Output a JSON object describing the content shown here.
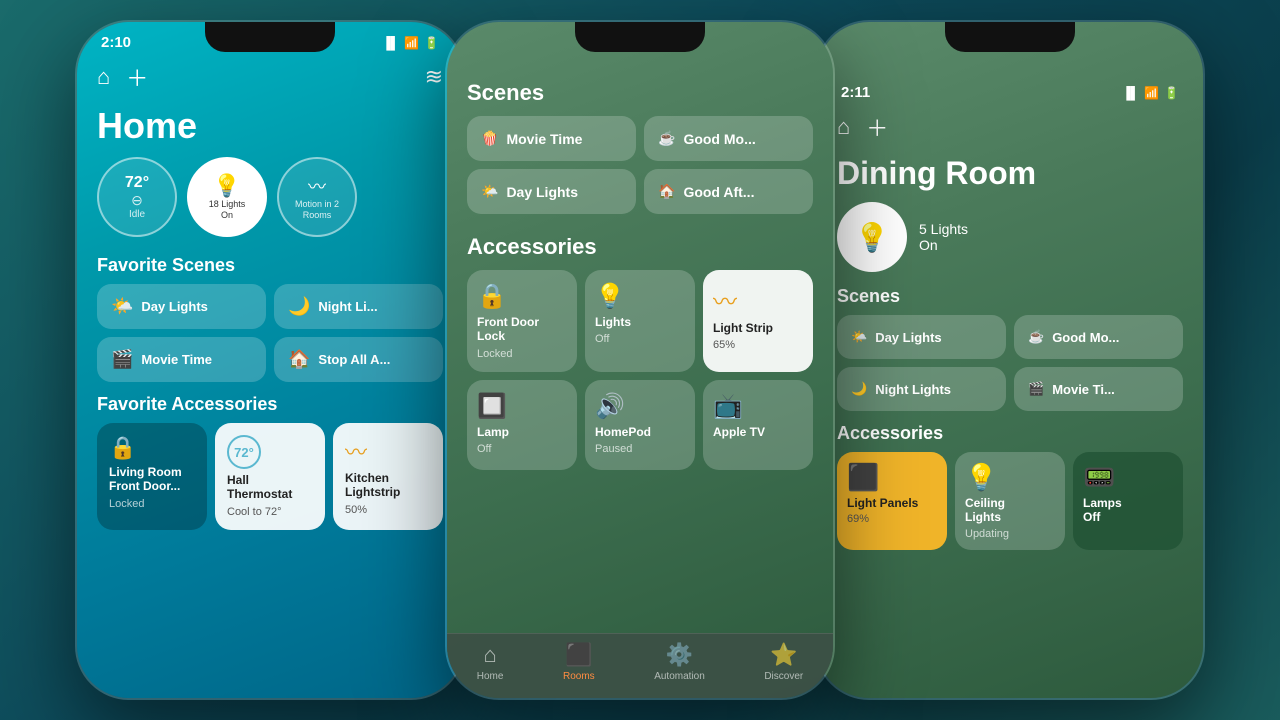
{
  "phones": {
    "left": {
      "time": "2:10",
      "title": "Home",
      "status_bubbles": [
        {
          "icon": "🌡️",
          "val": "72°",
          "sub": "Idle",
          "has_minus": true
        },
        {
          "icon": "💡",
          "val": "",
          "sub": "18 Lights\nOn",
          "active": true
        },
        {
          "icon": "〰️",
          "val": "",
          "sub": "Motion in 2\nRooms",
          "signal": true
        }
      ],
      "favorite_scenes_title": "Favorite Scenes",
      "favorite_scenes": [
        {
          "icon": "🌤️",
          "label": "Day Lights"
        },
        {
          "icon": "🌙",
          "label": "Night Li..."
        },
        {
          "icon": "🎬",
          "label": "Movie Time"
        },
        {
          "icon": "🏠",
          "label": "Stop All A..."
        }
      ],
      "favorite_accessories_title": "Favorite Accessories",
      "accessories": [
        {
          "icon": "🔒",
          "name": "Living Room\nFront Door...",
          "status": "Locked",
          "type": "dark"
        },
        {
          "icon": "🌡️",
          "name": "Hall\nThermostat",
          "status": "Cool to 72°",
          "val": "72°",
          "type": "white"
        },
        {
          "icon": "〰️",
          "name": "Kitchen\nLightstrip",
          "status": "50%",
          "type": "white"
        }
      ]
    },
    "middle": {
      "time": "",
      "scenes_title": "Scenes",
      "scenes": [
        {
          "icon": "🍿",
          "label": "Movie Time"
        },
        {
          "icon": "☕",
          "label": "Good Mo..."
        },
        {
          "icon": "🌤️",
          "label": "Day Lights"
        },
        {
          "icon": "🏠",
          "label": "Good Aft..."
        }
      ],
      "accessories_title": "Accessories",
      "accessories": [
        {
          "icon": "🔒",
          "name": "Front Door\nLock",
          "status": "Locked",
          "type": "normal"
        },
        {
          "icon": "💡",
          "name": "Lights",
          "status": "Off",
          "type": "normal"
        },
        {
          "icon": "〰️",
          "name": "Light Strip",
          "status": "65%",
          "type": "active"
        },
        {
          "icon": "🔲",
          "name": "Lamp",
          "status": "Off",
          "type": "normal"
        },
        {
          "icon": "🔊",
          "name": "HomePod",
          "status": "Paused",
          "type": "normal"
        },
        {
          "icon": "📺",
          "name": "Apple TV",
          "status": "",
          "type": "normal"
        }
      ],
      "tabs": [
        {
          "icon": "🏠",
          "label": "Home",
          "active": false
        },
        {
          "icon": "⬛",
          "label": "Rooms",
          "active": true
        },
        {
          "icon": "⚙️",
          "label": "Automation",
          "active": false
        },
        {
          "icon": "⭐",
          "label": "Discover",
          "active": false
        }
      ]
    },
    "right": {
      "time": "2:11",
      "title": "Dining Room",
      "light_count": "5 Lights",
      "light_state": "On",
      "scenes_title": "Scenes",
      "scenes": [
        {
          "icon": "🌤️",
          "label": "Day Lights"
        },
        {
          "icon": "☕",
          "label": "Good Mo..."
        },
        {
          "icon": "🌙",
          "label": "Night Lights"
        },
        {
          "icon": "🎬",
          "label": "Movie Ti..."
        }
      ],
      "accessories_title": "Accessories",
      "accessories": [
        {
          "icon": "⬛",
          "name": "Light Panels",
          "status": "69%",
          "type": "yellow"
        },
        {
          "icon": "💡",
          "name": "Ceiling\nLights",
          "status": "Updating",
          "type": "light"
        },
        {
          "icon": "📟",
          "name": "Lamps\nOff",
          "status": "",
          "type": "dark-green"
        }
      ]
    }
  }
}
